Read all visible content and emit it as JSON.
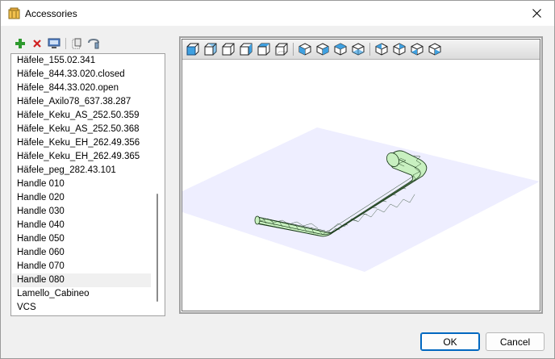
{
  "window": {
    "title": "Accessories"
  },
  "toolbar": {
    "icons": [
      "add-icon",
      "delete-icon",
      "edit-icon",
      "copy-icon",
      "paste-icon"
    ]
  },
  "accessory_list": {
    "items": [
      "Häfele_155.02.341",
      "Häfele_844.33.020.closed",
      "Häfele_844.33.020.open",
      "Häfele_Axilo78_637.38.287",
      "Häfele_Keku_AS_252.50.359",
      "Häfele_Keku_AS_252.50.368",
      "Häfele_Keku_EH_262.49.356",
      "Häfele_Keku_EH_262.49.365",
      "Häfele_peg_282.43.101",
      "Handle 010",
      "Handle 020",
      "Handle 030",
      "Handle 040",
      "Handle 050",
      "Handle 060",
      "Handle 070",
      "Handle 080",
      "Lamello_Cabineo",
      "VCS"
    ],
    "selected": "Handle 080"
  },
  "viewer": {
    "view_buttons": [
      "view-front-icon",
      "view-back-icon",
      "view-left-icon",
      "view-right-icon",
      "view-top-icon",
      "view-bottom-icon",
      "view-iso-1-icon",
      "view-iso-2-icon",
      "view-iso-3-icon",
      "view-iso-4-icon",
      "view-iso-5-icon",
      "view-iso-6-icon",
      "view-iso-7-icon",
      "view-iso-8-icon"
    ],
    "colors": {
      "plane": "#eeeeff",
      "handle_fill": "#c8f0c0",
      "handle_edges": "#1a3a1a"
    }
  },
  "buttons": {
    "ok": "OK",
    "cancel": "Cancel"
  }
}
